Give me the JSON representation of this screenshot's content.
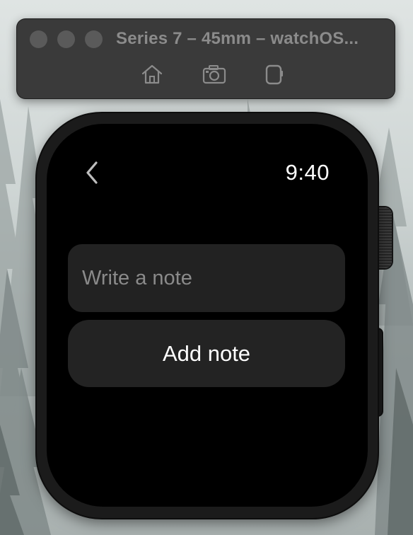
{
  "simulator": {
    "title": "Series 7 – 45mm – watchOS..."
  },
  "toolbar": {
    "icons": [
      "home-icon",
      "screenshot-camera-icon",
      "rotate-device-icon"
    ]
  },
  "watch": {
    "time": "9:40",
    "note_input": {
      "placeholder": "Write a note",
      "value": ""
    },
    "add_button_label": "Add note"
  },
  "colors": {
    "window": "#3a3a3a",
    "screen": "#000000",
    "control": "#222222",
    "text": "#ffffff",
    "placeholder": "#8a8a8a"
  }
}
